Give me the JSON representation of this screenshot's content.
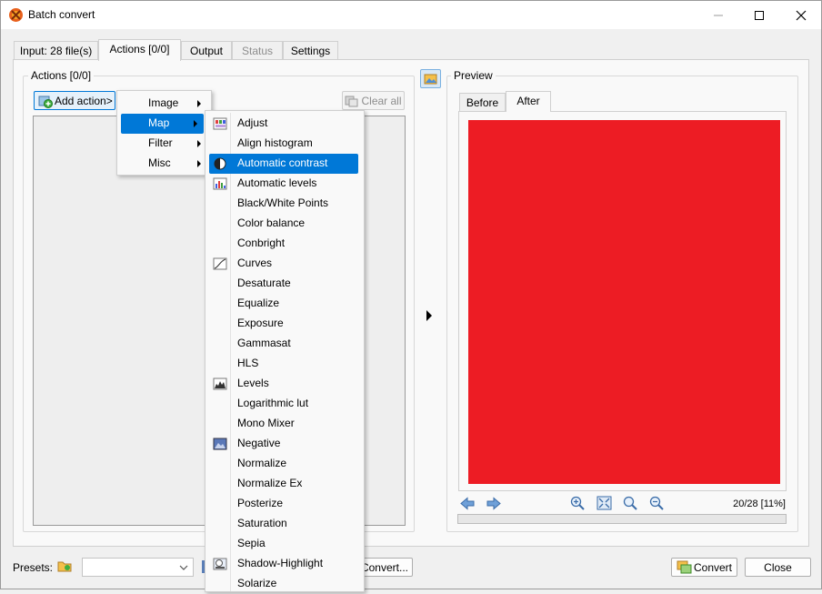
{
  "window": {
    "title": "Batch convert"
  },
  "tabs": [
    {
      "label": "Input: 28 file(s)"
    },
    {
      "label": "Actions [0/0]"
    },
    {
      "label": "Output"
    },
    {
      "label": "Status"
    },
    {
      "label": "Settings"
    }
  ],
  "actions_panel": {
    "group_title": "Actions [0/0]",
    "add_action_label": "Add action>",
    "clear_all_label": "Clear all"
  },
  "preview_panel": {
    "group_title": "Preview",
    "tabs": [
      {
        "label": "Before"
      },
      {
        "label": "After"
      }
    ],
    "image_color": "#ed1c24",
    "counter": "20/28 [11%]"
  },
  "category_menu": {
    "items": [
      {
        "label": "Image"
      },
      {
        "label": "Map"
      },
      {
        "label": "Filter"
      },
      {
        "label": "Misc"
      }
    ]
  },
  "map_submenu": {
    "items": [
      {
        "label": "Adjust",
        "icon": "adjust-icon"
      },
      {
        "label": "Align histogram",
        "icon": ""
      },
      {
        "label": "Automatic contrast",
        "icon": "contrast-icon"
      },
      {
        "label": "Automatic levels",
        "icon": "histogram-icon"
      },
      {
        "label": "Black/White Points",
        "icon": ""
      },
      {
        "label": "Color balance",
        "icon": ""
      },
      {
        "label": "Conbright",
        "icon": ""
      },
      {
        "label": "Curves",
        "icon": "curves-icon"
      },
      {
        "label": "Desaturate",
        "icon": ""
      },
      {
        "label": "Equalize",
        "icon": ""
      },
      {
        "label": "Exposure",
        "icon": ""
      },
      {
        "label": "Gammasat",
        "icon": ""
      },
      {
        "label": "HLS",
        "icon": ""
      },
      {
        "label": "Levels",
        "icon": "levels-icon"
      },
      {
        "label": "Logarithmic lut",
        "icon": ""
      },
      {
        "label": "Mono Mixer",
        "icon": ""
      },
      {
        "label": "Negative",
        "icon": "negative-icon"
      },
      {
        "label": "Normalize",
        "icon": ""
      },
      {
        "label": "Normalize Ex",
        "icon": ""
      },
      {
        "label": "Posterize",
        "icon": ""
      },
      {
        "label": "Saturation",
        "icon": ""
      },
      {
        "label": "Sepia",
        "icon": ""
      },
      {
        "label": "Shadow-Highlight",
        "icon": "shadow-highlight-icon"
      },
      {
        "label": "Solarize",
        "icon": ""
      }
    ]
  },
  "bottom_bar": {
    "presets_label": "Presets:",
    "preset_value": "",
    "convert_dots_label": "Convert...",
    "convert_label": "Convert",
    "close_label": "Close"
  }
}
